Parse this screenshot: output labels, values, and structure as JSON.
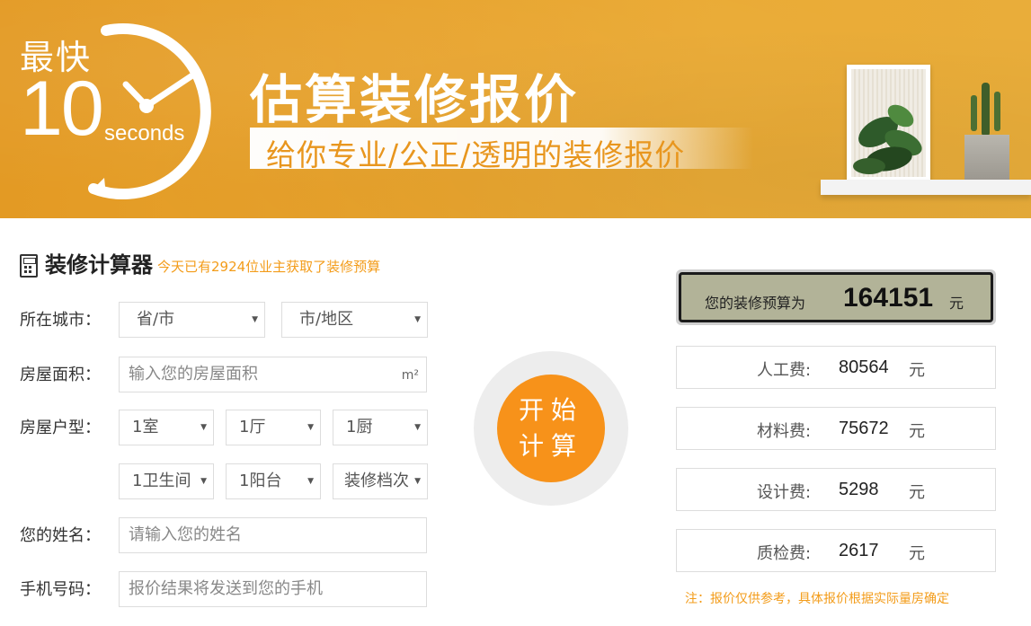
{
  "banner": {
    "fast_label": "最快",
    "number": "10",
    "seconds": "seconds",
    "title": "估算装修报价",
    "subtitle": "给你专业/公正/透明的装修报价"
  },
  "calculator": {
    "title": "装修计算器",
    "count_text": "今天已有2924位业主获取了装修预算",
    "city_label": "所在城市：",
    "province_value": "省/市",
    "district_value": "市/地区",
    "area_label": "房屋面积：",
    "area_placeholder": "输入您的房屋面积",
    "area_unit": "m²",
    "layout_label": "房屋户型：",
    "room_value": "1室",
    "hall_value": "1厅",
    "kitchen_value": "1厨",
    "bath_value": "1卫生间",
    "balcony_value": "1阳台",
    "grade_value": "装修档次",
    "name_label": "您的姓名：",
    "name_placeholder": "请输入您的姓名",
    "phone_label": "手机号码：",
    "phone_placeholder": "报价结果将发送到您的手机"
  },
  "calculate_button": {
    "line1": "开始",
    "line2": "计算"
  },
  "results": {
    "budget_label": "您的装修预算为",
    "budget_value": "164151",
    "budget_unit": "元",
    "items": [
      {
        "name": "人工费:",
        "value": "80564",
        "unit": "元"
      },
      {
        "name": "材料费:",
        "value": "75672",
        "unit": "元"
      },
      {
        "name": "设计费:",
        "value": "5298",
        "unit": "元"
      },
      {
        "name": "质检费:",
        "value": "2617",
        "unit": "元"
      }
    ],
    "note": "注：报价仅供参考，具体报价根据实际量房确定"
  },
  "colors": {
    "accent": "#f7921a",
    "banner": "#e8a42e",
    "note": "#f39c1a"
  }
}
